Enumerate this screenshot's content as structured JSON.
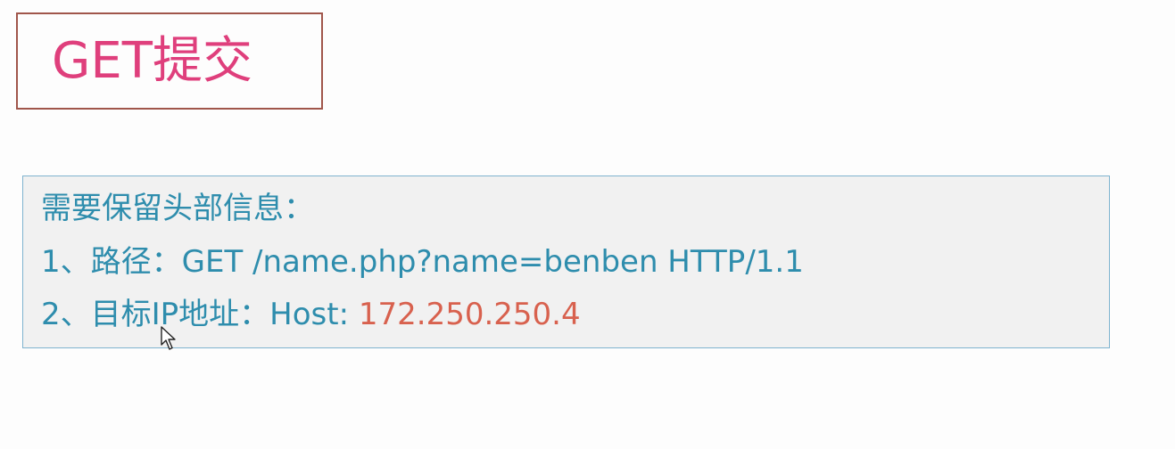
{
  "slide": {
    "title": "GET提交",
    "info": {
      "heading": "需要保留头部信息：",
      "path_label": "1、路径：",
      "path_value": "GET /name.php?name=benben HTTP/1.1",
      "target_label": "2、目标IP地址：",
      "host_prefix": "Host: ",
      "host_ip": "172.250.250.4"
    }
  },
  "colors": {
    "title": "#df3f7c",
    "title_border": "#a0564b",
    "body_text": "#2e8dad",
    "ip_highlight": "#d8614e",
    "info_border": "#7fb3cf",
    "info_background": "#f1f1f1"
  },
  "icons": {
    "cursor": "mouse-pointer-icon"
  }
}
